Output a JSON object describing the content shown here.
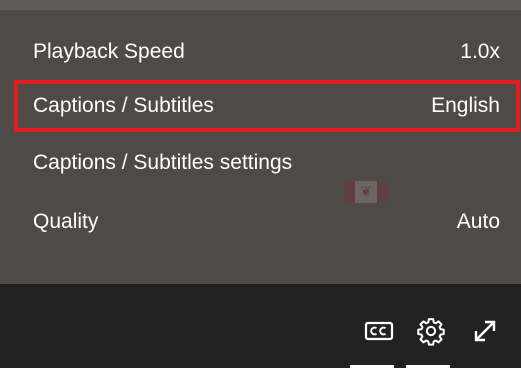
{
  "video": {
    "watermark_text": "Canada"
  },
  "settings_menu": {
    "items": [
      {
        "label": "Playback Speed",
        "value": "1.0x"
      },
      {
        "label": "Captions / Subtitles",
        "value": "English",
        "highlighted": true
      },
      {
        "label": "Captions / Subtitles settings",
        "value": ""
      },
      {
        "label": "Quality",
        "value": "Auto"
      }
    ]
  },
  "control_bar": {
    "icons": [
      "closed-captions-icon",
      "gear-icon",
      "fullscreen-icon"
    ]
  },
  "colors": {
    "highlight_border": "#e11d1d",
    "menu_background": "#5e5a56",
    "control_bar_background": "#222222",
    "text": "#ffffff"
  }
}
